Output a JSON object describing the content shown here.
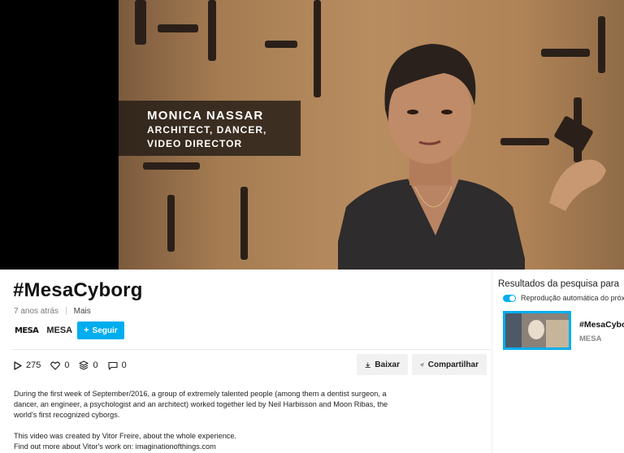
{
  "video": {
    "lower_third": {
      "name": "MONICA NASSAR",
      "roles": [
        "ARCHITECT, DANCER,",
        "VIDEO DIRECTOR"
      ]
    }
  },
  "page": {
    "title": "#MesaCyborg",
    "posted": "7 anos atrás",
    "more_label": "Mais"
  },
  "channel": {
    "logo_text": "MESA",
    "name": "MESA",
    "follow_label": "Seguir"
  },
  "stats": {
    "plays": "275",
    "likes": "0",
    "collections": "0",
    "comments": "0",
    "icons": [
      "play-icon",
      "heart-icon",
      "layers-icon",
      "comment-icon"
    ]
  },
  "actions": {
    "download_label": "Baixar",
    "share_label": "Compartilhar"
  },
  "description": {
    "paragraph1": "During the first week of September/2016, a group of extremely talented people (among them a dentist surgeon, a dancer, an engineer, a psychologist and an architect) worked together led by Neil Harbisson and Moon Ribas, the world's first recognized cyborgs.",
    "line2": "This video was created by Vitor Freire, about the whole experience.",
    "line3": "Find out more about Vitor's work on: imaginationofthings.com"
  },
  "sidebar": {
    "title": "Resultados da pesquisa para",
    "autoplay_label": "Reprodução automática do próximo",
    "autoplay_on": true,
    "items": [
      {
        "title": "#MesaCyborg",
        "channel": "MESA"
      }
    ]
  },
  "colors": {
    "accent": "#00adef",
    "button_bg": "#f1f1f1"
  }
}
